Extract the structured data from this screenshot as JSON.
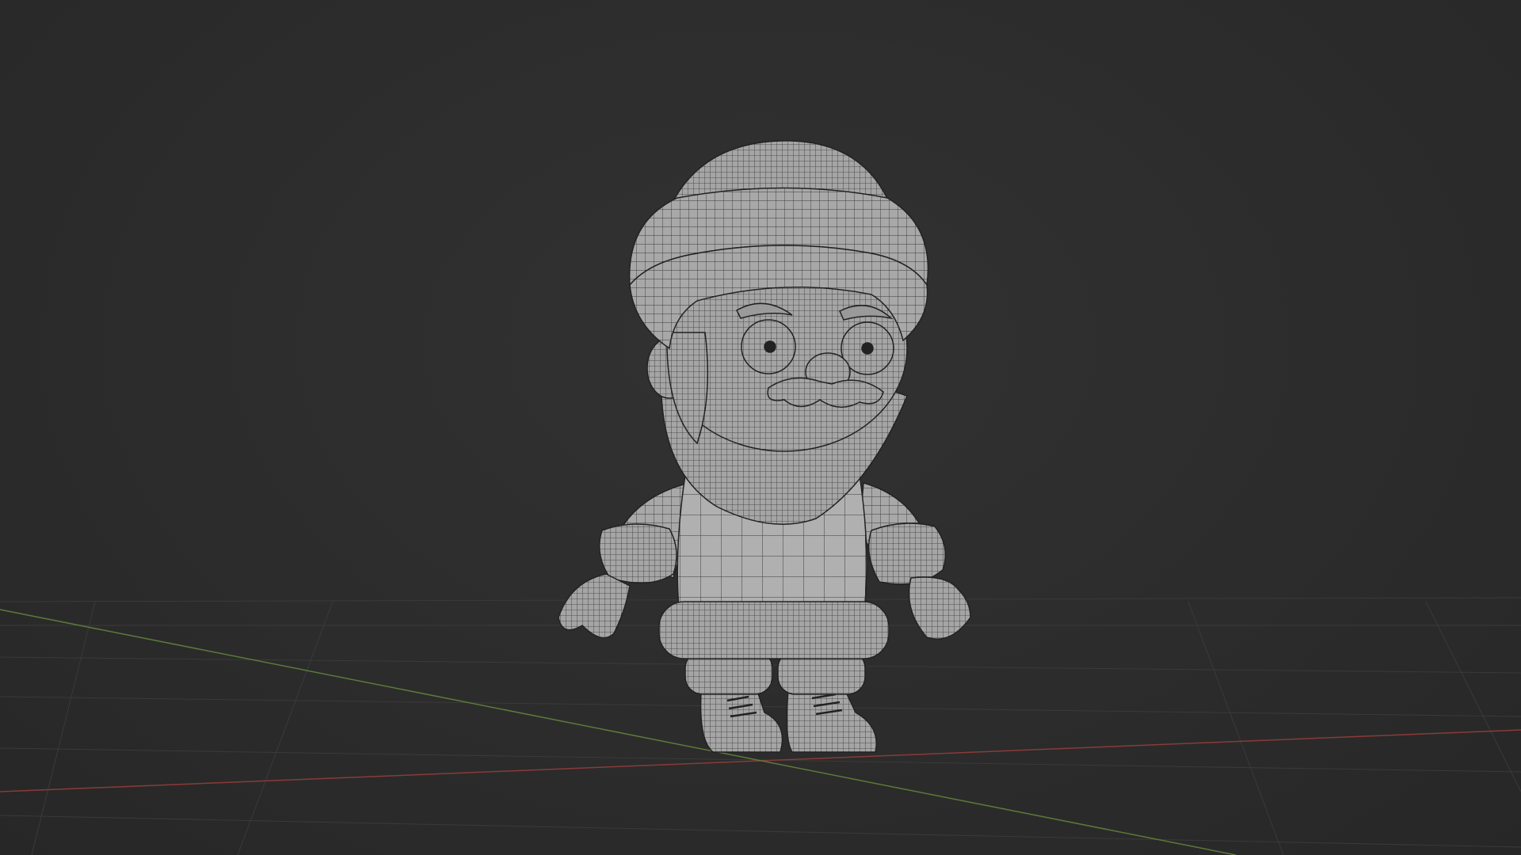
{
  "viewport": {
    "background": "#2c2c2c",
    "grid_color": "#3a3a3a",
    "x_axis_color": "#8a3a3a",
    "y_axis_color": "#5d7a3a"
  },
  "model": {
    "name": "santa-gnome-character",
    "display": "wireframe-over-solid",
    "base_color": "#a9a9a9",
    "wire_color": "#2e2e2e",
    "parts": [
      "hat",
      "hat-brim",
      "head",
      "ear",
      "eyebrows",
      "eyes",
      "nose",
      "mustache",
      "beard",
      "body",
      "sweater-hem",
      "sleeves",
      "cuffs",
      "mittens",
      "pant-cuffs",
      "boots"
    ]
  }
}
